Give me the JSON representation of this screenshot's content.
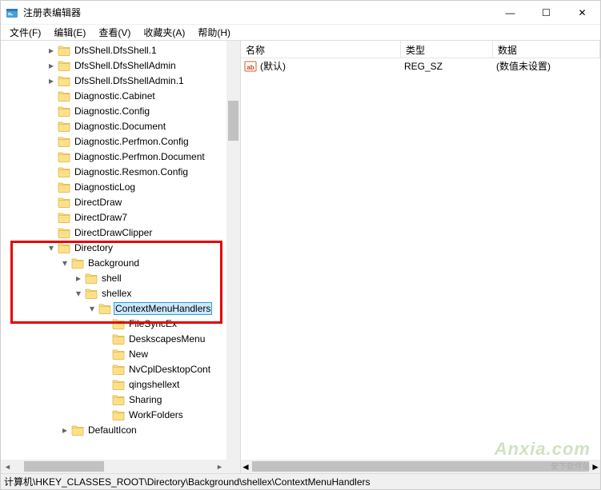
{
  "window": {
    "title": "注册表编辑器",
    "buttons": {
      "min": "—",
      "max": "☐",
      "close": "✕"
    }
  },
  "menu": [
    "文件(F)",
    "编辑(E)",
    "查看(V)",
    "收藏夹(A)",
    "帮助(H)"
  ],
  "tree": [
    {
      "indent": 2,
      "exp": "c",
      "label": "DfsShell.DfsShell.1"
    },
    {
      "indent": 2,
      "exp": "c",
      "label": "DfsShell.DfsShellAdmin"
    },
    {
      "indent": 2,
      "exp": "c",
      "label": "DfsShell.DfsShellAdmin.1"
    },
    {
      "indent": 2,
      "exp": "",
      "label": "Diagnostic.Cabinet"
    },
    {
      "indent": 2,
      "exp": "",
      "label": "Diagnostic.Config"
    },
    {
      "indent": 2,
      "exp": "",
      "label": "Diagnostic.Document"
    },
    {
      "indent": 2,
      "exp": "",
      "label": "Diagnostic.Perfmon.Config"
    },
    {
      "indent": 2,
      "exp": "",
      "label": "Diagnostic.Perfmon.Document"
    },
    {
      "indent": 2,
      "exp": "",
      "label": "Diagnostic.Resmon.Config"
    },
    {
      "indent": 2,
      "exp": "",
      "label": "DiagnosticLog"
    },
    {
      "indent": 2,
      "exp": "",
      "label": "DirectDraw"
    },
    {
      "indent": 2,
      "exp": "",
      "label": "DirectDraw7"
    },
    {
      "indent": 2,
      "exp": "",
      "label": "DirectDrawClipper"
    },
    {
      "indent": 2,
      "exp": "o",
      "label": "Directory"
    },
    {
      "indent": 3,
      "exp": "o",
      "label": "Background"
    },
    {
      "indent": 4,
      "exp": "c",
      "label": "shell"
    },
    {
      "indent": 4,
      "exp": "o",
      "label": "shellex"
    },
    {
      "indent": 5,
      "exp": "o",
      "label": "ContextMenuHandlers",
      "selected": true
    },
    {
      "indent": 6,
      "exp": "",
      "label": "FileSyncEx"
    },
    {
      "indent": 6,
      "exp": "",
      "label": "DeskscapesMenu"
    },
    {
      "indent": 6,
      "exp": "",
      "label": "New"
    },
    {
      "indent": 6,
      "exp": "",
      "label": "NvCplDesktopCont"
    },
    {
      "indent": 6,
      "exp": "",
      "label": "qingshellext"
    },
    {
      "indent": 6,
      "exp": "",
      "label": "Sharing"
    },
    {
      "indent": 6,
      "exp": "",
      "label": "WorkFolders"
    },
    {
      "indent": 3,
      "exp": "c",
      "label": "DefaultIcon"
    }
  ],
  "columns": {
    "name": "名称",
    "type": "类型",
    "data": "数据"
  },
  "rows": [
    {
      "name": "(默认)",
      "type": "REG_SZ",
      "data": "(数值未设置)"
    }
  ],
  "status": "计算机\\HKEY_CLASSES_ROOT\\Directory\\Background\\shellex\\ContextMenuHandlers",
  "watermark": {
    "main": "Anxia",
    "sub": ".com",
    "tag": "安下软件站"
  }
}
